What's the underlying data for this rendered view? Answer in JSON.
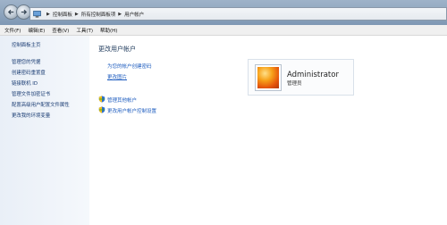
{
  "address_bar": {
    "crumbs": [
      "控制面板",
      "所有控制面板项",
      "用户帐户"
    ]
  },
  "menu": [
    "文件(F)",
    "编辑(E)",
    "查看(V)",
    "工具(T)",
    "帮助(H)"
  ],
  "sidebar": {
    "items": [
      {
        "label": "控制面板主页"
      },
      {
        "label": "管理您的凭据"
      },
      {
        "label": "创建密码重置盘"
      },
      {
        "label": "链接联机 ID"
      },
      {
        "label": "管理文件加密证书"
      },
      {
        "label": "配置高级用户配置文件属性"
      },
      {
        "label": "更改我的环境变量"
      }
    ]
  },
  "main": {
    "title": "更改用户帐户",
    "links": {
      "create_password": "为您的帐户创建密码",
      "change_picture": "更改图片",
      "manage_other": "管理其他帐户",
      "uac_settings": "更改用户帐户控制设置"
    }
  },
  "account": {
    "name": "Administrator",
    "role": "管理员"
  }
}
